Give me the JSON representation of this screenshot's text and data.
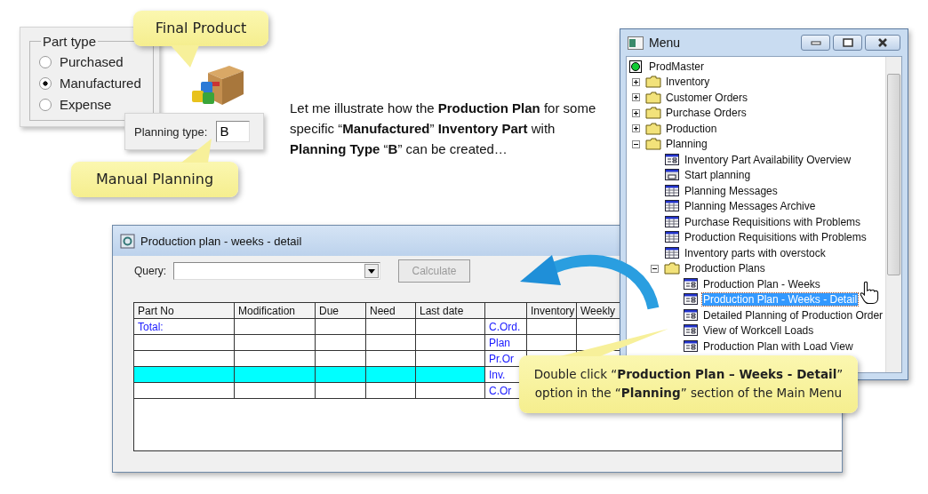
{
  "part_type_panel": {
    "legend": "Part type",
    "options": [
      {
        "label": "Purchased",
        "selected": false
      },
      {
        "label": "Manufactured",
        "selected": true
      },
      {
        "label": "Expense",
        "selected": false
      }
    ]
  },
  "planning_type": {
    "label": "Planning type:",
    "value": "B"
  },
  "callouts": [
    {
      "kind": "top",
      "text": "Final Product"
    },
    {
      "kind": "left",
      "text": "Manual Planning"
    },
    {
      "kind": "bottom",
      "text": "Double click “**Production  Plan – Weeks - Detail**”\noption in the “**Planning**”  section of the Main Menu"
    }
  ],
  "intro_text": "Let me illustrate how the **Production Plan** for some specific “**Manufactured**” **Inventory Part** with **Planning Type** “**B**” can be created…",
  "plan_window": {
    "title": "Production plan - weeks - detail",
    "query_label": "Query:",
    "calculate_button": {
      "label": "Calculate",
      "disabled": true
    },
    "columns": [
      {
        "label": "Part No"
      },
      {
        "label": "Modification"
      },
      {
        "label": "Due"
      },
      {
        "label": "Need"
      },
      {
        "label": "Last date"
      },
      {},
      {
        "label": "Inventory"
      },
      {
        "label": "Weekly"
      }
    ],
    "rows": [
      {
        "part_no": "Total:",
        "line_type": "C.Ord.",
        "highlighted": false
      },
      {
        "line_type": "Plan",
        "highlighted": false
      },
      {
        "line_type": "Pr.Or",
        "highlighted": false
      },
      {
        "line_type": "Inv.",
        "highlighted": true
      },
      {
        "line_type": "C.Or",
        "highlighted": false
      }
    ]
  },
  "menu_window": {
    "title": "Menu",
    "tree": [
      {
        "label": "ProdMaster",
        "kind": "root",
        "children": [
          {
            "label": "Inventory",
            "kind": "folder",
            "expanded": false
          },
          {
            "label": "Customer Orders",
            "kind": "folder",
            "expanded": false
          },
          {
            "label": "Purchase Orders",
            "kind": "folder",
            "expanded": false
          },
          {
            "label": "Production",
            "kind": "folder",
            "expanded": false
          },
          {
            "label": "Planning",
            "kind": "folder",
            "expanded": true,
            "children": [
              {
                "label": "Inventory Part Availability Overview",
                "kind": "form",
                "selected": false
              },
              {
                "label": "Start planning",
                "kind": "ok",
                "selected": false
              },
              {
                "label": "Planning Messages",
                "kind": "grid",
                "selected": false
              },
              {
                "label": "Planning Messages Archive",
                "kind": "grid",
                "selected": false
              },
              {
                "label": "Purchase Requisitions with Problems",
                "kind": "grid",
                "selected": false
              },
              {
                "label": "Production Requisitions with Problems",
                "kind": "grid",
                "selected": false
              },
              {
                "label": "Inventory parts with overstock",
                "kind": "grid",
                "selected": false
              },
              {
                "label": "Production Plans",
                "kind": "folder",
                "expanded": true,
                "children": [
                  {
                    "label": "Production Plan - Weeks",
                    "kind": "form",
                    "selected": false
                  },
                  {
                    "label": "Production Plan - Weeks - Detail",
                    "kind": "form",
                    "selected": true
                  },
                  {
                    "label": "Detailed Planning of Production Order",
                    "kind": "form",
                    "selected": false
                  },
                  {
                    "label": "View of Workcell Loads",
                    "kind": "form",
                    "selected": false
                  },
                  {
                    "label": "Production Plan with Load View",
                    "kind": "form",
                    "selected": false
                  }
                ]
              }
            ]
          }
        ]
      }
    ]
  }
}
